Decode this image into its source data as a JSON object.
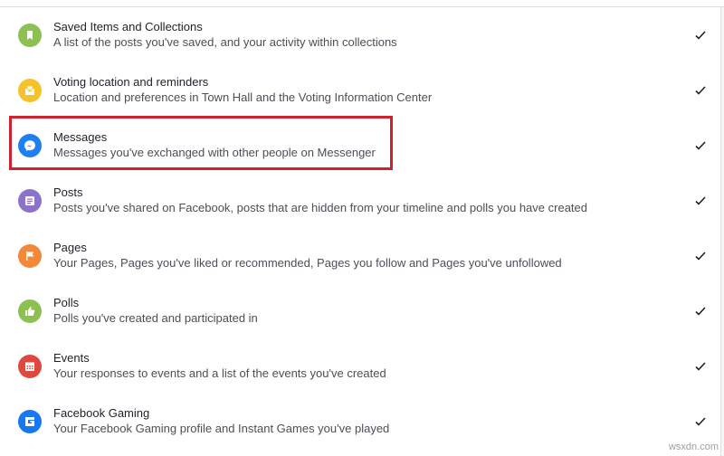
{
  "items": [
    {
      "title": "Saved Items and Collections",
      "desc": "A list of the posts you've saved, and your activity within collections",
      "icon": "bookmark-icon",
      "color": "#8cc152"
    },
    {
      "title": "Voting location and reminders",
      "desc": "Location and preferences in Town Hall and the Voting Information Center",
      "icon": "ballot-box-icon",
      "color": "#f6c22b"
    },
    {
      "title": "Messages",
      "desc": "Messages you've exchanged with other people on Messenger",
      "icon": "messenger-icon",
      "color": "#1e80f0"
    },
    {
      "title": "Posts",
      "desc": "Posts you've shared on Facebook, posts that are hidden from your timeline and polls you have created",
      "icon": "post-icon",
      "color": "#8c72cb"
    },
    {
      "title": "Pages",
      "desc": "Your Pages, Pages you've liked or recommended, Pages you follow and Pages you've unfollowed",
      "icon": "flag-icon",
      "color": "#f2883a"
    },
    {
      "title": "Polls",
      "desc": "Polls you've created and participated in",
      "icon": "thumbs-up-icon",
      "color": "#8cc152"
    },
    {
      "title": "Events",
      "desc": "Your responses to events and a list of the events you've created",
      "icon": "calendar-icon",
      "color": "#e0473f"
    },
    {
      "title": "Facebook Gaming",
      "desc": "Your Facebook Gaming profile and Instant Games you've played",
      "icon": "gaming-icon",
      "color": "#1877f2"
    }
  ],
  "checked": [
    true,
    true,
    true,
    true,
    true,
    true,
    true,
    true
  ],
  "highlight_color": "#d0222e",
  "watermark": "wsxdn.com"
}
